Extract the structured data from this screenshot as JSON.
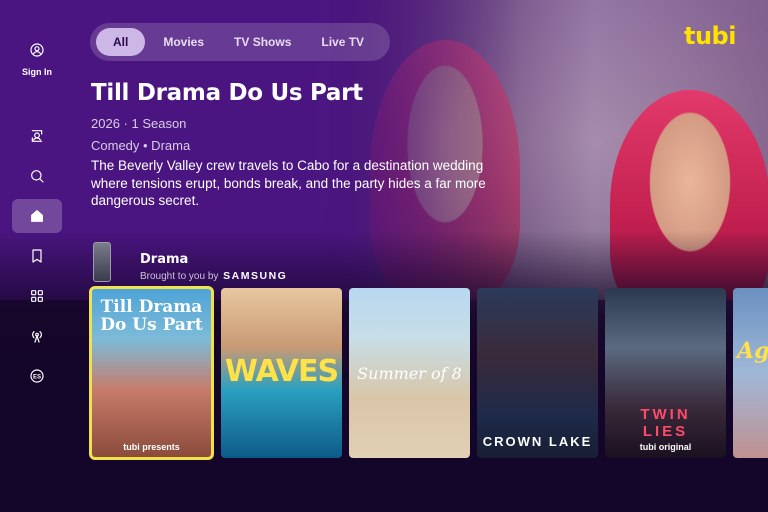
{
  "sidebar": {
    "signin_label": "Sign In",
    "items": [
      {
        "icon": "profile-switch-icon"
      },
      {
        "icon": "search-icon"
      },
      {
        "icon": "home-icon",
        "active": true
      },
      {
        "icon": "bookmark-icon"
      },
      {
        "icon": "categories-icon"
      },
      {
        "icon": "live-antenna-icon"
      },
      {
        "icon": "espanol-icon",
        "label": "ES"
      }
    ]
  },
  "tabs": [
    {
      "label": "All",
      "active": true
    },
    {
      "label": "Movies"
    },
    {
      "label": "TV Shows"
    },
    {
      "label": "Live TV"
    }
  ],
  "logo": "tubi",
  "hero": {
    "title": "Till Drama Do Us Part",
    "meta": "2026 · 1 Season",
    "genre": "Comedy • Drama",
    "description": "The Beverly Valley crew travels to Cabo for a destination wedding where tensions erupt, bonds break, and the party hides a far more dangerous secret."
  },
  "row": {
    "title": "Drama",
    "sponsor_prefix": "Brought to you by",
    "sponsor": "SAMSUNG"
  },
  "posters": [
    {
      "title": "Till Drama Do Us Part",
      "badge": "tubi presents",
      "selected": true
    },
    {
      "title": "WAVES"
    },
    {
      "title": "Summer of 8"
    },
    {
      "title": "CROWN LAKE"
    },
    {
      "title": "TWIN LIES",
      "badge": "tubi original"
    },
    {
      "title": "Age"
    }
  ],
  "colors": {
    "accent": "#ffe200",
    "selection": "#f0e24a",
    "tab_active": "#cdb7e6"
  }
}
